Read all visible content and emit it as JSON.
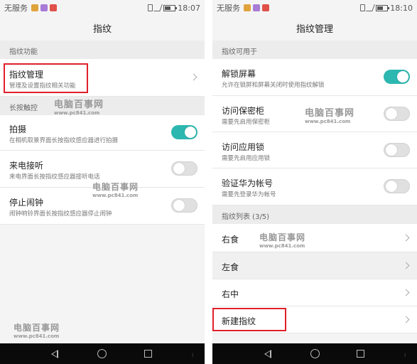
{
  "left": {
    "status": {
      "carrier": "无服务",
      "time": "18:07"
    },
    "title": "指纹",
    "section1": "指纹功能",
    "manage": {
      "title": "指纹管理",
      "sub": "管理及设置指纹相关功能"
    },
    "section2": "长按触控",
    "items": [
      {
        "title": "拍摄",
        "sub": "在相机取景界面长按指纹感应器进行拍摄",
        "on": true
      },
      {
        "title": "来电接听",
        "sub": "来电界面长按指纹感应器接听电话",
        "on": false
      },
      {
        "title": "停止闹钟",
        "sub": "闹钟响铃界面长按指纹感应器停止闹钟",
        "on": false
      }
    ]
  },
  "right": {
    "status": {
      "carrier": "无服务",
      "time": "18:10"
    },
    "title": "指纹管理",
    "section1": "指纹可用于",
    "items": [
      {
        "title": "解锁屏幕",
        "sub": "允许在锁屏和屏幕关闭时使用指纹解锁",
        "on": true
      },
      {
        "title": "访问保密柜",
        "sub": "需要先启用保密柜",
        "on": false
      },
      {
        "title": "访问应用锁",
        "sub": "需要先启用应用锁",
        "on": false
      },
      {
        "title": "验证华为帐号",
        "sub": "需要先登录华为帐号",
        "on": false
      }
    ],
    "section2": "指纹列表 (3/5)",
    "fingerprints": [
      "右食",
      "左食",
      "右中"
    ],
    "new_fingerprint": "新建指纹"
  },
  "watermark": {
    "cn": "电脑百事网",
    "url": "www.pc841.com"
  },
  "colors": {
    "accent": "#2cb7b0",
    "highlight_box": "#e0202a"
  }
}
